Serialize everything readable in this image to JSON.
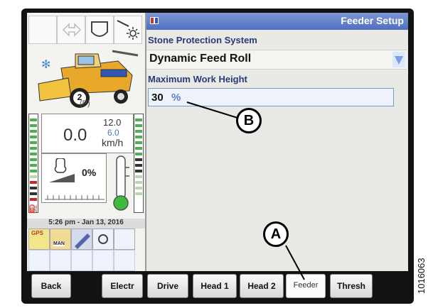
{
  "left_panel": {
    "park_label": "(P)",
    "gear": "2",
    "speed": {
      "value": "0.0",
      "max": "12.0",
      "min": "6.0",
      "unit": "km/h"
    },
    "load_percent": "0%",
    "datetime": "5:26 pm - Jan 13, 2016",
    "quick_icons": {
      "gps": "GPS",
      "man": "MAN"
    }
  },
  "main": {
    "title": "Feeder Setup",
    "stone_protection": {
      "label": "Stone Protection System",
      "value": "Dynamic Feed Roll"
    },
    "max_work_height": {
      "label": "Maximum Work Height",
      "value": "30",
      "unit": "%"
    }
  },
  "nav": {
    "back": "Back",
    "tabs": [
      "Electr",
      "Drive",
      "Head 1",
      "Head 2",
      "Feeder",
      "Thresh"
    ],
    "active_tab": "Feeder"
  },
  "callouts": {
    "a": "A",
    "b": "B"
  },
  "figure_id": "1016063",
  "colors": {
    "title_bar": "#5f7dc8",
    "label_blue": "#2a3a78",
    "unit_blue": "#5a7dd2",
    "bezel": "#121212"
  }
}
